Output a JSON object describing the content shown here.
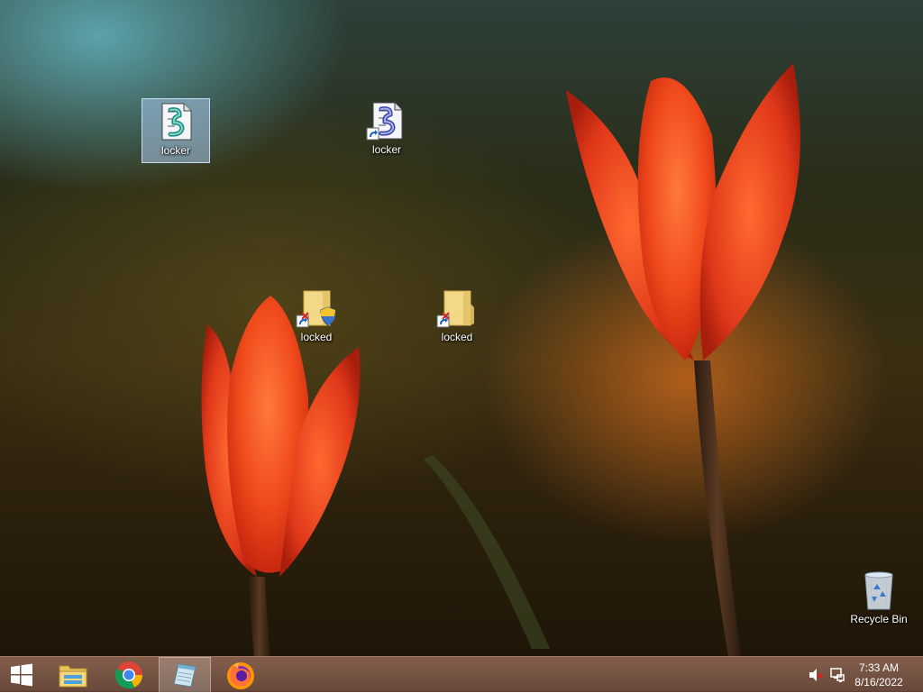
{
  "desktop": {
    "icons": [
      {
        "label": "locker",
        "type": "script-file",
        "selected": true
      },
      {
        "label": "locker",
        "type": "script-shortcut",
        "selected": false
      },
      {
        "label": "locked",
        "type": "folder-shortcut-shield",
        "selected": false
      },
      {
        "label": "locked",
        "type": "folder-shortcut",
        "selected": false
      },
      {
        "label": "Recycle Bin",
        "type": "recycle-bin",
        "selected": false
      }
    ]
  },
  "taskbar": {
    "buttons": [
      {
        "name": "start-button",
        "icon": "windows-logo-icon"
      },
      {
        "name": "file-explorer",
        "icon": "folder-icon"
      },
      {
        "name": "google-chrome",
        "icon": "chrome-icon"
      },
      {
        "name": "notepad",
        "icon": "notepad-icon",
        "active": true
      },
      {
        "name": "firefox",
        "icon": "firefox-icon"
      }
    ],
    "tray": {
      "volume": "muted-speaker-icon",
      "network": "network-icon"
    },
    "clock": {
      "time": "7:33 AM",
      "date": "8/16/2022"
    }
  },
  "colors": {
    "taskbar": "#6e4636",
    "selection": "#aac8eb",
    "tulip": "#e8401e"
  }
}
